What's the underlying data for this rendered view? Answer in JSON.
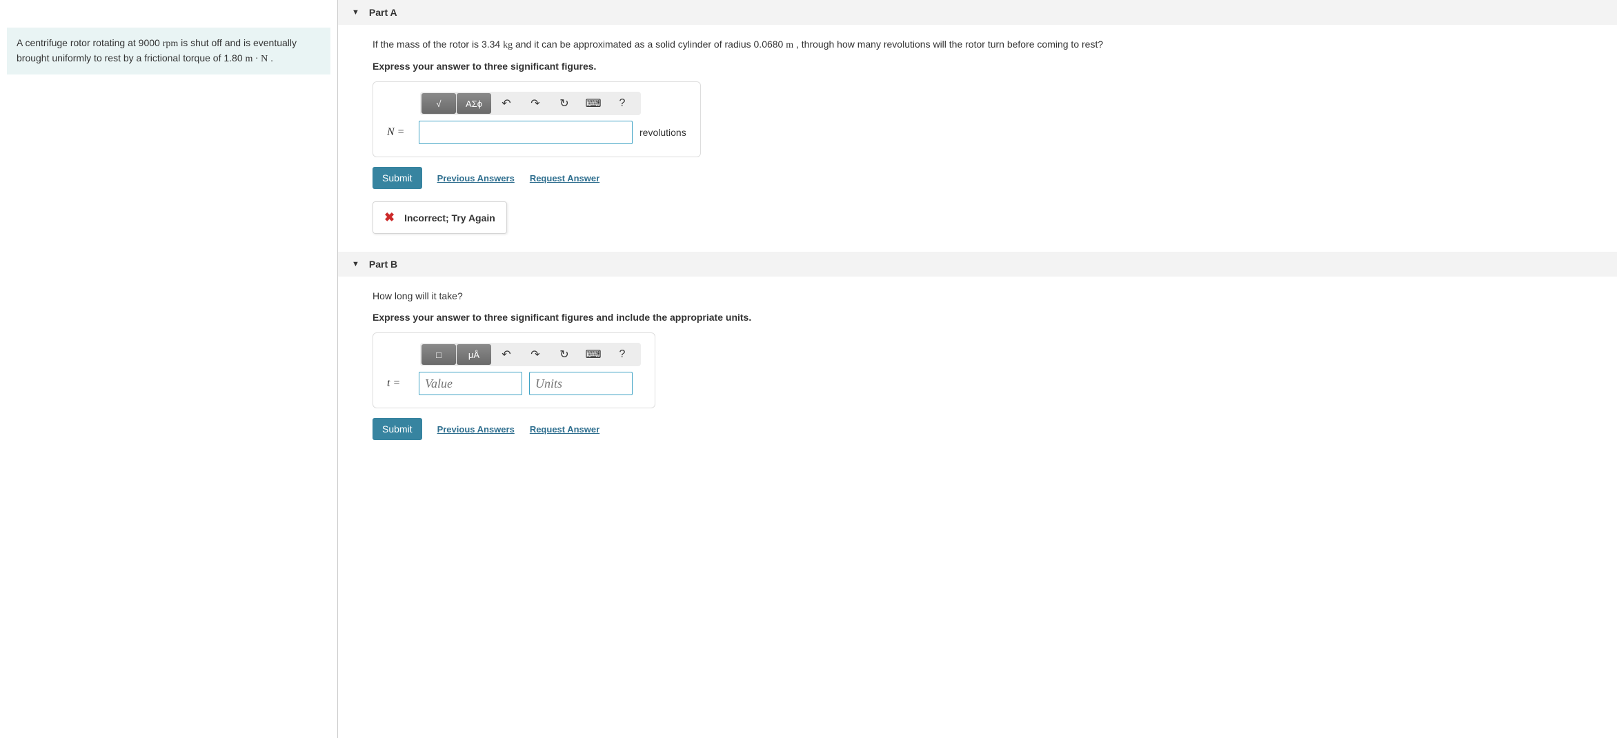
{
  "problem": {
    "prefix": "A centrifuge rotor rotating at 9000 ",
    "unit1": "rpm",
    "middle": " is shut off and is eventually brought uniformly to rest by a frictional torque of 1.80 ",
    "unit2": "m · N",
    "suffix": " ."
  },
  "partA": {
    "title": "Part A",
    "question_pre": "If the mass of the rotor is 3.34 ",
    "q_unit_kg": "kg",
    "question_mid": " and it can be approximated as a solid cylinder of radius 0.0680 ",
    "q_unit_m": "m",
    "question_post": " , through how many revolutions will the rotor turn before coming to rest?",
    "instruction": "Express your answer to three significant figures.",
    "toolbar": {
      "templates": "√",
      "greek": "ΑΣϕ",
      "undo": "↶",
      "redo": "↷",
      "reset": "↻",
      "keyboard": "⌨",
      "help": "?"
    },
    "var_label": "N =",
    "unit_suffix": "revolutions",
    "submit": "Submit",
    "prev_answers": "Previous Answers",
    "request_answer": "Request Answer",
    "feedback": "Incorrect; Try Again"
  },
  "partB": {
    "title": "Part B",
    "question": "How long will it take?",
    "instruction": "Express your answer to three significant figures and include the appropriate units.",
    "toolbar": {
      "templates": "□",
      "units": "μÅ",
      "undo": "↶",
      "redo": "↷",
      "reset": "↻",
      "keyboard": "⌨",
      "help": "?"
    },
    "var_label": "t =",
    "value_placeholder": "Value",
    "units_placeholder": "Units",
    "submit": "Submit",
    "prev_answers": "Previous Answers",
    "request_answer": "Request Answer"
  }
}
